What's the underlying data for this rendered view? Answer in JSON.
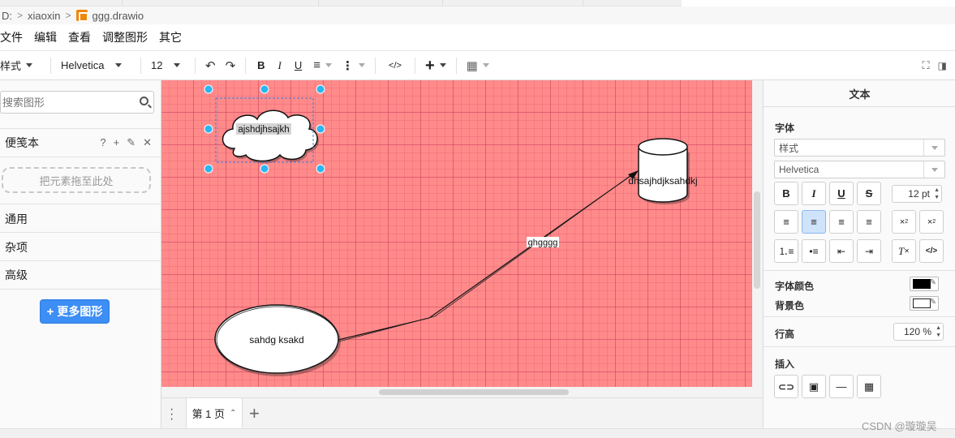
{
  "breadcrumb": {
    "drive": "D:",
    "folder": "xiaoxin",
    "file": "ggg.drawio"
  },
  "menu": [
    "文件",
    "编辑",
    "查看",
    "调整图形",
    "其它"
  ],
  "toolbar": {
    "style_label": "样式",
    "font_name": "Helvetica",
    "font_size": "12"
  },
  "left": {
    "search_placeholder": "搜索图形",
    "scratchpad": "便笺本",
    "scratch_help": "?",
    "dropzone": "把元素拖至此处",
    "sections": [
      "通用",
      "杂项",
      "高级"
    ],
    "more_shapes": "更多图形"
  },
  "diagram": {
    "cloud_text": "ajshdjhsajkh",
    "ellipse_text": "sahdg ksakd",
    "cylinder_text": "dhsajhdjksahdkj",
    "edge_label": "ghgggg",
    "canvas_color": "#ff8a8a"
  },
  "pages": {
    "current": "第 1 页"
  },
  "format": {
    "header": "文本",
    "font_section": "字体",
    "style_select": "样式",
    "font_select": "Helvetica",
    "font_size": "12 pt",
    "font_color_label": "字体颜色",
    "font_color": "#000000",
    "bg_color_label": "背景色",
    "bg_color": "#ffffff",
    "line_height_label": "行高",
    "line_height": "120 %",
    "insert_label": "插入"
  },
  "watermark": "CSDN @璇璇吴"
}
